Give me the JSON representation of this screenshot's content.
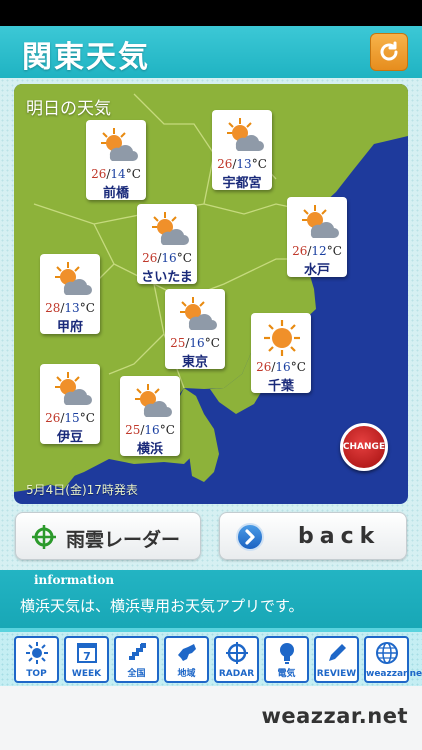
{
  "header": {
    "title": "関東天気",
    "refresh_icon": "refresh-icon"
  },
  "map": {
    "title": "明日の天気",
    "issued": "5月4日(金)17時発表",
    "change_label": "CHANGE",
    "colors": {
      "sea": "#1e3a9c",
      "land": "#8db23a",
      "border": "#c9d98a"
    },
    "cities": [
      {
        "id": "maebashi",
        "name": "前橋",
        "hi": "26",
        "lo": "14",
        "icon": "sun-cloud-icon"
      },
      {
        "id": "utsunomiya",
        "name": "宇都宮",
        "hi": "26",
        "lo": "13",
        "icon": "sun-cloud-icon"
      },
      {
        "id": "saitama",
        "name": "さいたま",
        "hi": "26",
        "lo": "16",
        "icon": "sun-cloud-icon"
      },
      {
        "id": "mito",
        "name": "水戸",
        "hi": "26",
        "lo": "12",
        "icon": "sun-cloud-icon"
      },
      {
        "id": "kofu",
        "name": "甲府",
        "hi": "28",
        "lo": "13",
        "icon": "sun-cloud-icon"
      },
      {
        "id": "tokyo",
        "name": "東京",
        "hi": "25",
        "lo": "16",
        "icon": "sun-cloud-icon"
      },
      {
        "id": "chiba",
        "name": "千葉",
        "hi": "26",
        "lo": "16",
        "icon": "sun-icon"
      },
      {
        "id": "izu",
        "name": "伊豆",
        "hi": "26",
        "lo": "15",
        "icon": "sun-cloud-icon"
      },
      {
        "id": "yokohama",
        "name": "横浜",
        "hi": "25",
        "lo": "16",
        "icon": "sun-cloud-icon"
      }
    ]
  },
  "buttons": {
    "radar": "雨雲レーダー",
    "back": "back"
  },
  "info": {
    "label": "information",
    "text": "横浜天気は、横浜専用お天気アプリです。"
  },
  "tabs": [
    "TOP",
    "WEEK",
    "全国",
    "地域",
    "RADAR",
    "電気",
    "REVIEW",
    "weazzar.net"
  ],
  "tab_week_number": "7",
  "footer": {
    "brand": "weazzar.net"
  }
}
